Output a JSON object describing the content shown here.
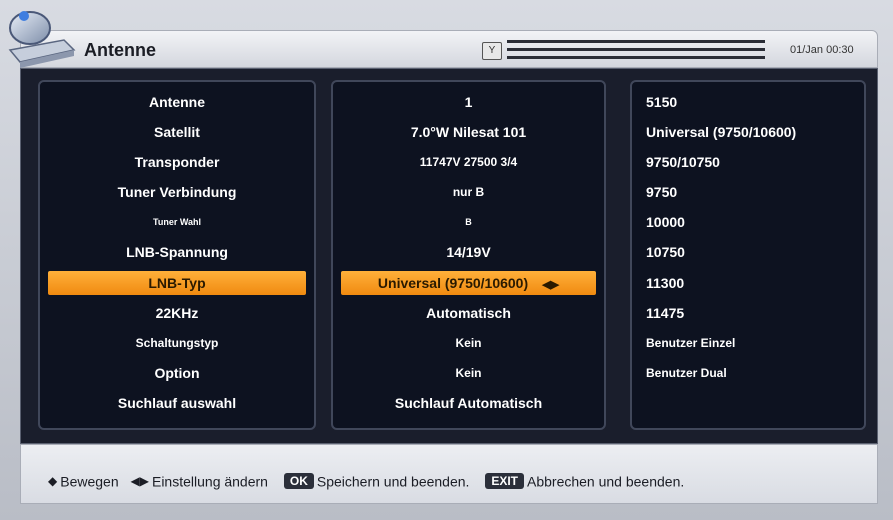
{
  "header": {
    "title": "Antenne",
    "clock": "01/Jan 00:30"
  },
  "columns": {
    "labels": [
      "Antenne",
      "Satellit",
      "Transponder",
      "Tuner Verbindung",
      "Tuner Wahl",
      "LNB-Spannung",
      "LNB-Typ",
      "22KHz",
      "Schaltungstyp",
      "Option",
      "Suchlauf auswahl"
    ],
    "values": [
      "1",
      "7.0°W Nilesat 101",
      "11747V 27500 3/4",
      "nur B",
      "B",
      "14/19V",
      "Universal (9750/10600)",
      "Automatisch",
      "Kein",
      "Kein",
      "Suchlauf Automatisch"
    ],
    "options": [
      "5150",
      "Universal (9750/10600)",
      "9750/10750",
      "9750",
      "10000",
      "10750",
      "11300",
      "11475",
      "Benutzer Einzel",
      "Benutzer Dual"
    ],
    "selected_index": 6
  },
  "footer": {
    "move": "Bewegen",
    "change": "Einstellung ändern",
    "ok_key": "OK",
    "ok_text": "Speichern und beenden.",
    "exit_key": "EXIT",
    "exit_text": "Abbrechen und beenden."
  },
  "icons": {
    "logo": "satellite-dish-icon",
    "signal": "signal-icon",
    "move": "up-down-arrows-icon",
    "change": "left-right-arrows-icon"
  }
}
